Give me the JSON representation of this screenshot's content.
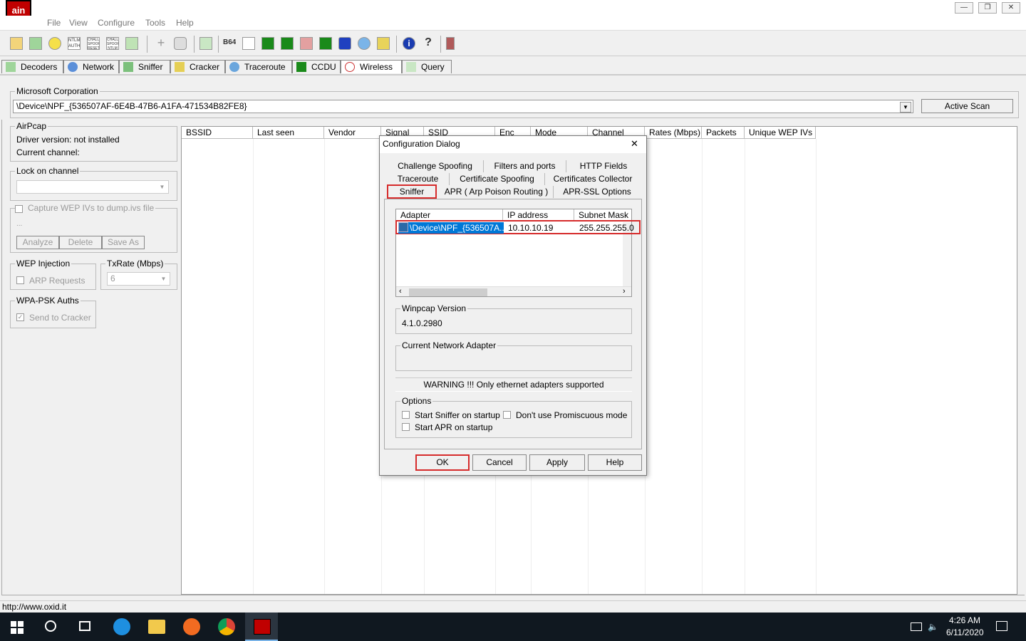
{
  "window": {
    "logo_text": "ain",
    "minimize": "—",
    "restore": "❐",
    "close": "✕"
  },
  "menu": [
    "File",
    "View",
    "Configure",
    "Tools",
    "Help"
  ],
  "toolbar": {
    "icons": [
      "open-folder-icon",
      "add-to-list-icon",
      "radioactive-icon",
      "ntlm-auth-icon",
      "challenge-spoof-reset-icon",
      "challenge-spoof-ntlm-icon",
      "monitor-icon",
      "plus-icon",
      "shield-icon",
      "certificate-icon",
      "base64-icon",
      "edit-icon",
      "lsa-secrets-icon",
      "wep-icon",
      "pc-icon",
      "keyboard-icon",
      "cisco-icon",
      "network-globe-icon",
      "key-icon",
      "info-icon",
      "help-icon",
      "figure-icon"
    ],
    "labels": {
      "ntlm": "NTLM AUTH",
      "cs1": "CHALL SPOOF RESET",
      "cs2": "CHALL SPOOF NTLM",
      "b64": "B64"
    }
  },
  "main_tabs": [
    {
      "label": "Decoders",
      "icon": "decoders-icon"
    },
    {
      "label": "Network",
      "icon": "network-icon"
    },
    {
      "label": "Sniffer",
      "icon": "sniffer-icon"
    },
    {
      "label": "Cracker",
      "icon": "cracker-icon"
    },
    {
      "label": "Traceroute",
      "icon": "traceroute-icon"
    },
    {
      "label": "CCDU",
      "icon": "ccdu-icon"
    },
    {
      "label": "Wireless",
      "icon": "wireless-icon"
    },
    {
      "label": "Query",
      "icon": "query-icon"
    }
  ],
  "adapter_group": {
    "label": "Microsoft Corporation",
    "value": "\\Device\\NPF_{536507AF-6E4B-47B6-A1FA-471534B82FE8}",
    "active_scan": "Active Scan"
  },
  "airpcap": {
    "label": "AirPcap",
    "driver": "Driver version: not installed",
    "channel": "Current channel:"
  },
  "lock_channel": {
    "label": "Lock on channel"
  },
  "capture": {
    "label": "Capture WEP IVs to dump.ivs file",
    "ellipsis": "...",
    "analyze": "Analyze",
    "delete": "Delete",
    "save_as": "Save As"
  },
  "wep_injection": {
    "label": "WEP Injection",
    "arp": "ARP Requests"
  },
  "txrate": {
    "label": "TxRate (Mbps)",
    "value": "6"
  },
  "wpa": {
    "label": "WPA-PSK Auths",
    "send": "Send to Cracker"
  },
  "grid_columns": [
    "BSSID",
    "Last seen",
    "Vendor",
    "Signal",
    "SSID",
    "Enc",
    "Mode",
    "Channel",
    "Rates (Mbps)",
    "Packets",
    "Unique WEP IVs"
  ],
  "status": {
    "url": "http://www.oxid.it"
  },
  "taskbar": {
    "time": "4:26 AM",
    "date": "6/11/2020"
  },
  "dialog": {
    "title": "Configuration Dialog",
    "close": "✕",
    "tabs_row1": [
      "Challenge Spoofing",
      "Filters and ports",
      "HTTP Fields"
    ],
    "tabs_row2": [
      "Traceroute",
      "Certificate Spoofing",
      "Certificates Collector"
    ],
    "tabs_row3": [
      "Sniffer",
      "APR ( Arp Poison Routing )",
      "APR-SSL Options"
    ],
    "table_headers": [
      "Adapter",
      "IP address",
      "Subnet Mask"
    ],
    "row": {
      "adapter": "\\Device\\NPF_{536507A...",
      "ip": "10.10.10.19",
      "mask": "255.255.255.0"
    },
    "winpcap_label": "Winpcap Version",
    "winpcap_value": "4.1.0.2980",
    "current_adapter_label": "Current Network Adapter",
    "warning": "WARNING !!! Only ethernet adapters supported",
    "options_label": "Options",
    "opt_sniffer": "Start Sniffer on startup",
    "opt_apr": "Start APR on startup",
    "opt_promisc": "Don't use Promiscuous mode",
    "ok": "OK",
    "cancel": "Cancel",
    "apply": "Apply",
    "help": "Help"
  },
  "colors": {
    "highlight": "#d62b2b",
    "selection": "#0078d7"
  }
}
